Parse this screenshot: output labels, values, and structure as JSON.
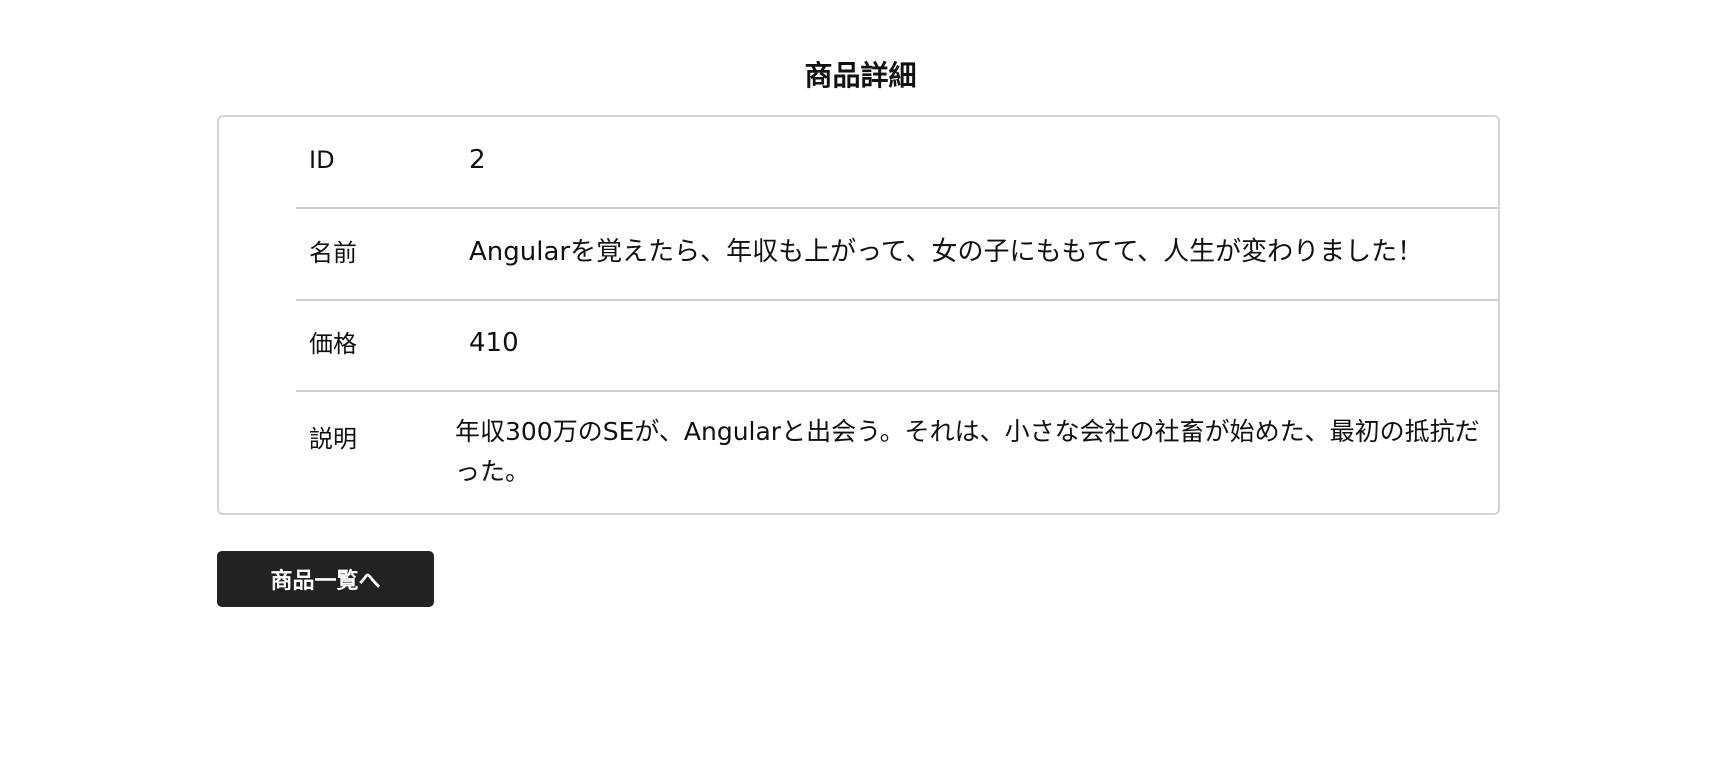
{
  "page": {
    "title": "商品詳細"
  },
  "product": {
    "fields": [
      {
        "label": "ID",
        "value": "2"
      },
      {
        "label": "名前",
        "value": "Angularを覚えたら、年収も上がって、女の子にももてて、人生が変わりました！"
      },
      {
        "label": "価格",
        "value": "410"
      },
      {
        "label": "説明",
        "value": "年収300万のSEが、Angularと出会う。それは、小さな会社の社畜が始めた、最初の抵抗だった。"
      }
    ]
  },
  "actions": {
    "back_label": "商品一覧へ"
  },
  "colors": {
    "button_bg": "#222222",
    "button_text": "#ffffff",
    "border": "#d4d4d4"
  }
}
